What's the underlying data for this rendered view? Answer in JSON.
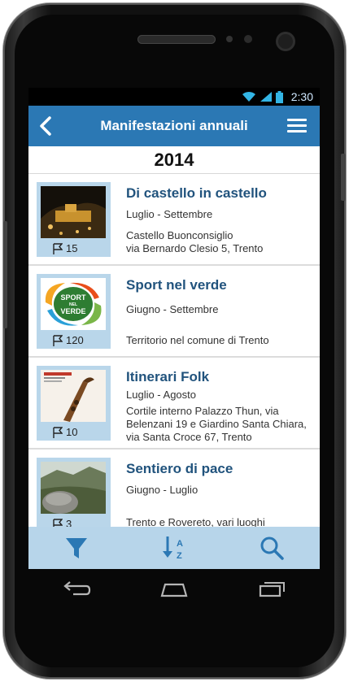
{
  "status": {
    "time": "2:30"
  },
  "header": {
    "title": "Manifestazioni annuali"
  },
  "year": "2014",
  "events": [
    {
      "name": "Di castello in castello",
      "dates": "Luglio - Settembre",
      "location": "Castello Buonconsiglio\nvia Bernardo Clesio 5, Trento",
      "count": "15"
    },
    {
      "name": "Sport nel verde",
      "dates": "Giugno - Settembre",
      "location": "Territorio nel comune di Trento",
      "count": "120",
      "logo_text": "SPORT NEL VERDE"
    },
    {
      "name": "Itinerari Folk",
      "dates": "Luglio - Agosto",
      "location": "Cortile interno Palazzo Thun, via Belenzani 19 e Giardino Santa Chiara, via Santa Croce 67, Trento",
      "count": "10"
    },
    {
      "name": "Sentiero di pace",
      "dates": "Giugno - Luglio",
      "location": "Trento e Rovereto, vari luoghi",
      "count": "3"
    }
  ],
  "toolbar": {
    "filter_icon": "filter-icon",
    "sort_icon": "sort-az-icon",
    "search_icon": "search-icon"
  },
  "colors": {
    "accent": "#2b78b4",
    "bottom_bar": "#b7d5ea",
    "title_text": "#21537d"
  }
}
